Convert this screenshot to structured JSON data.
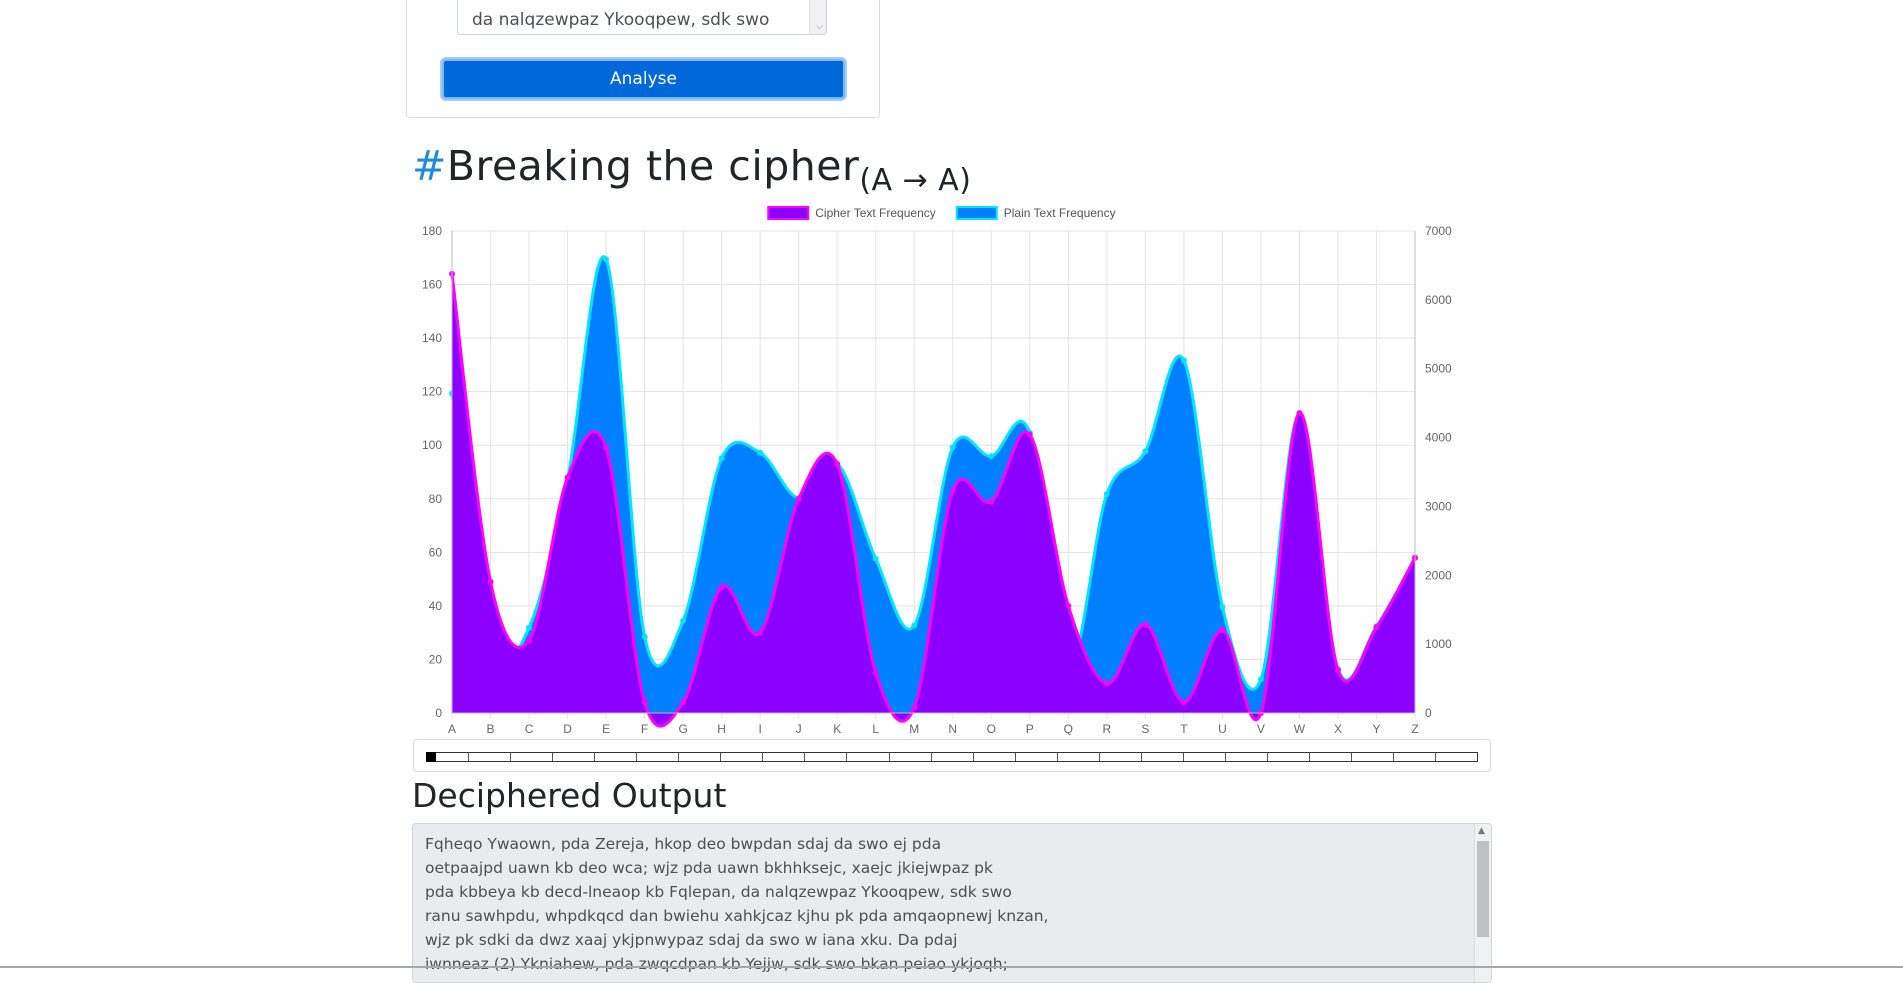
{
  "input": {
    "text": "da nalqzewpaz Ykooqpew, sdk swo",
    "analyse_label": "Analyse"
  },
  "heading": {
    "hash": "#",
    "title": "Breaking the cipher",
    "subscript": "(A → A)"
  },
  "chart_data": {
    "type": "area",
    "categories": [
      "A",
      "B",
      "C",
      "D",
      "E",
      "F",
      "G",
      "H",
      "I",
      "J",
      "K",
      "L",
      "M",
      "N",
      "O",
      "P",
      "Q",
      "R",
      "S",
      "T",
      "U",
      "V",
      "W",
      "X",
      "Y",
      "Z"
    ],
    "series": [
      {
        "name": "Cipher Text Frequency",
        "axis": "left",
        "color": "#8b00ff",
        "border": "#ff00ff",
        "values": [
          164,
          49,
          27,
          88,
          99,
          4,
          4,
          47,
          30,
          80,
          93,
          15,
          2,
          83,
          79,
          104,
          40,
          11,
          33,
          4,
          31,
          0,
          112,
          16,
          32,
          58
        ]
      },
      {
        "name": "Plain Text Frequency",
        "axis": "right",
        "color": "#0080ff",
        "border": "#00e5ff",
        "values": [
          4640,
          960,
          1240,
          3400,
          6590,
          1110,
          1340,
          3700,
          3780,
          3120,
          3620,
          2240,
          1270,
          3860,
          3730,
          4070,
          690,
          3180,
          3800,
          5120,
          1540,
          490,
          4350,
          640,
          1260,
          2250
        ]
      }
    ],
    "y_left": {
      "min": 0,
      "max": 180,
      "ticks": [
        0,
        20,
        40,
        60,
        80,
        100,
        120,
        140,
        160,
        180
      ]
    },
    "y_right": {
      "min": 0,
      "max": 7000,
      "ticks": [
        0,
        1000,
        2000,
        3000,
        4000,
        5000,
        6000,
        7000
      ]
    },
    "grid": true,
    "legend_position": "top"
  },
  "slider": {
    "value": 0,
    "min": 0,
    "max": 25
  },
  "output": {
    "heading": "Deciphered Output",
    "lines": [
      "Fqheqo Ywaown, pda Zereja, hkop deo bwpdan sdaj da swo ej pda",
      "oetpaajpd uawn kb deo wca; wjz pda uawn bkhhksejc, xaejc jkiejwpaz pk",
      "pda kbbeya kb decd-lneaop kb Fqlepan, da nalqzewpaz Ykooqpew, sdk swo",
      "ranu sawhpdu, whpdkqcd dan bwiehu xahkjcaz kjhu pk pda amqaopnewj knzan,",
      "wjz pk sdki da dwz xaaj ykjpnwypaz sdaj da swo w iana xku.  Da pdaj",
      "iwnneaz (2) Ykniahew, pda zwqcdpan kb Yejjw, sdk swo bkan peiao ykjoqh;"
    ]
  }
}
